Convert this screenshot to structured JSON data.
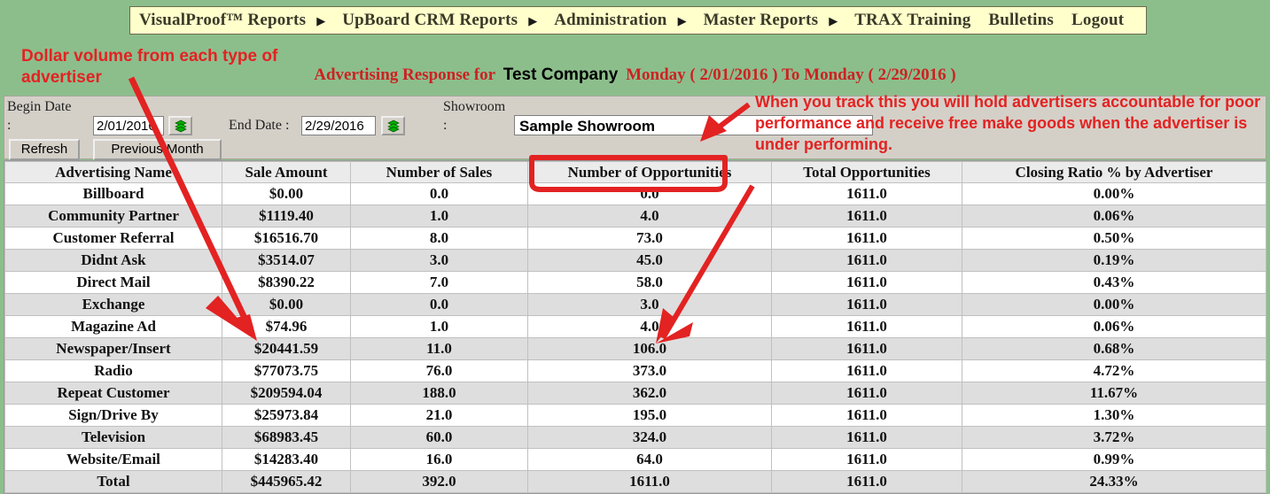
{
  "menubar": {
    "items": [
      {
        "label": "VisualProof™ Reports",
        "has_arrow": true
      },
      {
        "label": "UpBoard CRM Reports",
        "has_arrow": true
      },
      {
        "label": "Administration",
        "has_arrow": true
      },
      {
        "label": "Master Reports",
        "has_arrow": true
      },
      {
        "label": "TRAX Training",
        "has_arrow": false
      },
      {
        "label": "Bulletins",
        "has_arrow": false
      },
      {
        "label": "Logout",
        "has_arrow": false
      }
    ],
    "arrow_glyph": "▶"
  },
  "report_header": {
    "prefix": "Advertising Response for",
    "company": "Test Company",
    "date_range": "Monday ( 2/01/2016 ) To Monday ( 2/29/2016 )",
    "red_color": "#cc2222"
  },
  "controls": {
    "begin_date_label": "Begin Date :",
    "begin_date_value": "2/01/2016",
    "end_date_label": "End Date :",
    "end_date_value": "2/29/2016",
    "showroom_label": "Showroom :",
    "showroom_value": "Sample Showroom",
    "calendar_icon": "calendar-picker-icon",
    "refresh_label": "Refresh",
    "previous_month_label": "Previous Month"
  },
  "table": {
    "columns": [
      "Advertising Name",
      "Sale Amount",
      "Number of Sales",
      "Number of Opportunities",
      "Total Opportunities",
      "Closing Ratio % by Advertiser"
    ],
    "rows": [
      [
        "Billboard",
        "$0.00",
        "0.0",
        "0.0",
        "1611.0",
        "0.00%"
      ],
      [
        "Community Partner",
        "$1119.40",
        "1.0",
        "4.0",
        "1611.0",
        "0.06%"
      ],
      [
        "Customer Referral",
        "$16516.70",
        "8.0",
        "73.0",
        "1611.0",
        "0.50%"
      ],
      [
        "Didnt Ask",
        "$3514.07",
        "3.0",
        "45.0",
        "1611.0",
        "0.19%"
      ],
      [
        "Direct Mail",
        "$8390.22",
        "7.0",
        "58.0",
        "1611.0",
        "0.43%"
      ],
      [
        "Exchange",
        "$0.00",
        "0.0",
        "3.0",
        "1611.0",
        "0.00%"
      ],
      [
        "Magazine Ad",
        "$74.96",
        "1.0",
        "4.0",
        "1611.0",
        "0.06%"
      ],
      [
        "Newspaper/Insert",
        "$20441.59",
        "11.0",
        "106.0",
        "1611.0",
        "0.68%"
      ],
      [
        "Radio",
        "$77073.75",
        "76.0",
        "373.0",
        "1611.0",
        "4.72%"
      ],
      [
        "Repeat Customer",
        "$209594.04",
        "188.0",
        "362.0",
        "1611.0",
        "11.67%"
      ],
      [
        "Sign/Drive By",
        "$25973.84",
        "21.0",
        "195.0",
        "1611.0",
        "1.30%"
      ],
      [
        "Television",
        "$68983.45",
        "60.0",
        "324.0",
        "1611.0",
        "3.72%"
      ],
      [
        "Website/Email",
        "$14283.40",
        "16.0",
        "64.0",
        "1611.0",
        "0.99%"
      ],
      [
        "Total",
        "$445965.42",
        "392.0",
        "1611.0",
        "1611.0",
        "24.33%"
      ]
    ]
  },
  "annotations": {
    "left_note": "Dollar volume from each type of advertiser",
    "right_note": "When you track this you will hold advertisers accountable for poor performance and receive free make goods when the advertiser is under performing.",
    "color": "#e32222",
    "highlight_target_column": "Number of Opportunities"
  }
}
